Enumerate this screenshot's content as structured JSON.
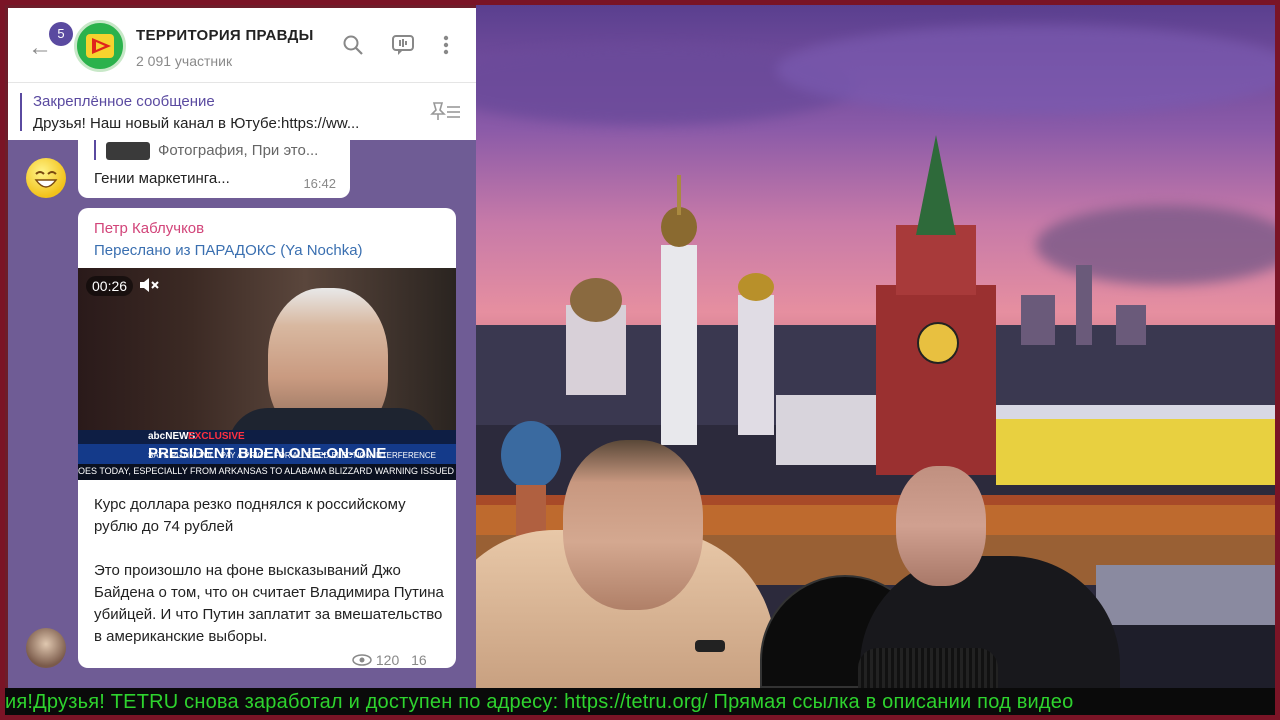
{
  "header": {
    "unread_count": "5",
    "channel_title": "ТЕРРИТОРИЯ ПРАВДЫ",
    "members": "2 091 участник"
  },
  "pinned": {
    "title": "Закреплённое сообщение",
    "text": "Друзья! Наш новый канал в Ютубе:https://ww..."
  },
  "message_prev": {
    "reply_preview": "Фотография, При это...",
    "text": "Гении маркетинга...",
    "time": "16:42"
  },
  "message": {
    "sender": "Петр Каблучков",
    "forwarded": "Переслано из ПАРАДОКС (Ya Nochka)",
    "video_duration": "00:26",
    "video_overlay": {
      "network": "abcNEWS",
      "tag": "EXCLUSIVE",
      "headline": "PRESIDENT BIDEN ONE-ON-ONE",
      "subline": "SAYS PUTIN \"WILL PAY A PRICE\" FOR ALLEGED ELECTION INTERFERENCE",
      "crawl": "OES TODAY, ESPECIALLY FROM ARKANSAS TO ALABAMA   BLIZZARD WARNING ISSUED FOR"
    },
    "paragraph1": "Курс доллара резко поднялся к российскому рублю до 74 рублей",
    "paragraph2": "Это произошло на фоне высказываний Джо Байдена о том, что он считает Владимира Путина убийцей. И что Путин заплатит за вмешательство в американские выборы.",
    "views": "120",
    "time_partial": "16"
  },
  "ticker": {
    "text": "ия!Друзья! TETRU снова заработал и доступен по адресу: https://tetru.org/ Прямая ссылка в описании под видео"
  },
  "colors": {
    "frame": "#7a1426",
    "tg_bg": "#6f5c95",
    "accent": "#5a4aa0",
    "ticker_text": "#2ed32e"
  },
  "icons": [
    "back-arrow-icon",
    "search-icon",
    "voice-chat-icon",
    "more-vert-icon",
    "unpin-icon",
    "mute-icon",
    "eye-icon"
  ]
}
